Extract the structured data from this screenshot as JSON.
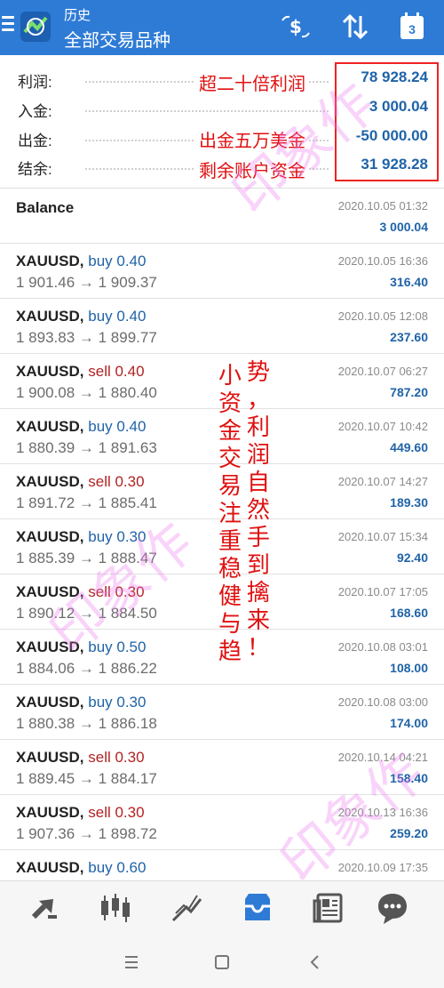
{
  "header": {
    "title_small": "历史",
    "title_main": "全部交易品种",
    "calendar_day": "3"
  },
  "summary": [
    {
      "label": "利润:",
      "value": "78 928.24"
    },
    {
      "label": "入金:",
      "value": "3 000.04"
    },
    {
      "label": "出金:",
      "value": "-50 000.00"
    },
    {
      "label": "结余:",
      "value": "31 928.28"
    }
  ],
  "annotations": {
    "profit_note": "超二十倍利润",
    "withdraw_note": "出金五万美金",
    "balance_note": "剩余账户资金",
    "column_left": "小资金交易注重稳健与趋",
    "column_right": "势，利润自然手到擒来！",
    "watermark": "印象作"
  },
  "balance_entry": {
    "title": "Balance",
    "time": "2020.10.05 01:32",
    "amount": "3 000.04"
  },
  "deals": [
    {
      "symbol": "XAUUSD,",
      "side": "buy 0.40",
      "type": "buy",
      "prices": "1 901.46 → 1 909.37",
      "time": "2020.10.05 16:36",
      "profit": "316.40"
    },
    {
      "symbol": "XAUUSD,",
      "side": "buy 0.40",
      "type": "buy",
      "prices": "1 893.83 → 1 899.77",
      "time": "2020.10.05 12:08",
      "profit": "237.60"
    },
    {
      "symbol": "XAUUSD,",
      "side": "sell 0.40",
      "type": "sell",
      "prices": "1 900.08 → 1 880.40",
      "time": "2020.10.07 06:27",
      "profit": "787.20"
    },
    {
      "symbol": "XAUUSD,",
      "side": "buy 0.40",
      "type": "buy",
      "prices": "1 880.39 → 1 891.63",
      "time": "2020.10.07 10:42",
      "profit": "449.60"
    },
    {
      "symbol": "XAUUSD,",
      "side": "sell 0.30",
      "type": "sell",
      "prices": "1 891.72 → 1 885.41",
      "time": "2020.10.07 14:27",
      "profit": "189.30"
    },
    {
      "symbol": "XAUUSD,",
      "side": "buy 0.30",
      "type": "buy",
      "prices": "1 885.39 → 1 888.47",
      "time": "2020.10.07 15:34",
      "profit": "92.40"
    },
    {
      "symbol": "XAUUSD,",
      "side": "sell 0.30",
      "type": "sell",
      "prices": "1 890.12 → 1 884.50",
      "time": "2020.10.07 17:05",
      "profit": "168.60"
    },
    {
      "symbol": "XAUUSD,",
      "side": "buy 0.50",
      "type": "buy",
      "prices": "1 884.06 → 1 886.22",
      "time": "2020.10.08 03:01",
      "profit": "108.00"
    },
    {
      "symbol": "XAUUSD,",
      "side": "buy 0.30",
      "type": "buy",
      "prices": "1 880.38 → 1 886.18",
      "time": "2020.10.08 03:00",
      "profit": "174.00"
    },
    {
      "symbol": "XAUUSD,",
      "side": "sell 0.30",
      "type": "sell",
      "prices": "1 889.45 → 1 884.17",
      "time": "2020.10.14 04:21",
      "profit": "158.40"
    },
    {
      "symbol": "XAUUSD,",
      "side": "sell 0.30",
      "type": "sell",
      "prices": "1 907.36 → 1 898.72",
      "time": "2020.10.13 16:36",
      "profit": "259.20"
    },
    {
      "symbol": "XAUUSD,",
      "side": "buy 0.60",
      "type": "buy",
      "prices": "",
      "time": "2020.10.09 17:35",
      "profit": ""
    }
  ],
  "colors": {
    "header_bg": "#2e7bd6",
    "value_blue": "#1f63a8",
    "sell_red": "#b22222",
    "annotation_red": "#e01010",
    "active_tab": "#2e7bd6"
  },
  "bottom_nav": [
    {
      "name": "quotes-icon",
      "active": false
    },
    {
      "name": "chart-icon",
      "active": false
    },
    {
      "name": "trade-icon",
      "active": false
    },
    {
      "name": "history-icon",
      "active": true
    },
    {
      "name": "news-icon",
      "active": false
    },
    {
      "name": "messages-icon",
      "active": false
    }
  ]
}
